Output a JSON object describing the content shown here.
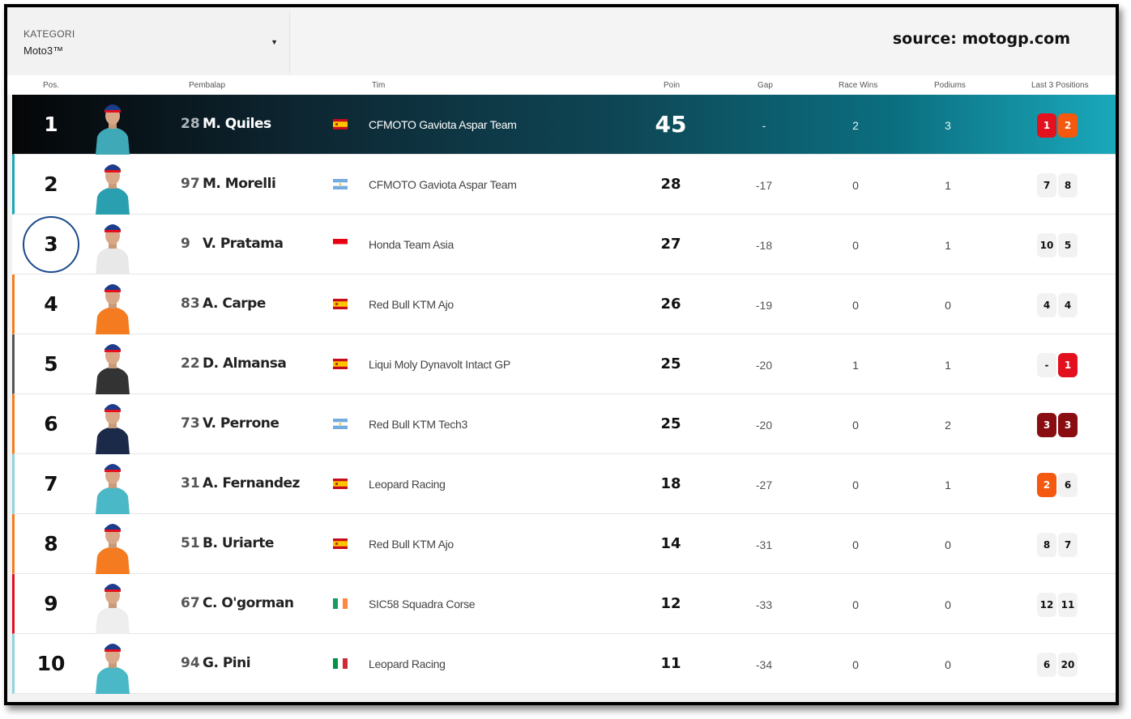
{
  "category": {
    "label": "KATEGORI",
    "value": "Moto3™"
  },
  "source_text": "source: motogp.com",
  "headers": {
    "pos": "Pos.",
    "rider": "Pembalap",
    "team": "Tim",
    "points": "Poin",
    "gap": "Gap",
    "wins": "Race Wins",
    "podiums": "Podiums",
    "last3": "Last 3 Positions"
  },
  "colors": {
    "accent_teal": "#1aa8bb",
    "podium_1": "#e3101e",
    "podium_2": "#f4590f",
    "podium_3": "#8a0d12",
    "highlight_circle": "#1a4a8a"
  },
  "rows": [
    {
      "pos": "1",
      "num": "28",
      "name": "M. Quiles",
      "flag": "spain-flag",
      "team": "CFMOTO Gaviota Aspar Team",
      "points": "45",
      "gap": "-",
      "wins": "2",
      "podiums": "3",
      "last": [
        "1",
        "2"
      ],
      "stripe": "#000000"
    },
    {
      "pos": "2",
      "num": "97",
      "name": "M. Morelli",
      "flag": "argentina-flag",
      "team": "CFMOTO Gaviota Aspar Team",
      "points": "28",
      "gap": "-17",
      "wins": "0",
      "podiums": "1",
      "last": [
        "7",
        "8"
      ],
      "stripe": "#1aa8bb"
    },
    {
      "pos": "3",
      "num": "9",
      "name": "V. Pratama",
      "flag": "indonesia-flag",
      "team": "Honda Team Asia",
      "points": "27",
      "gap": "-18",
      "wins": "0",
      "podiums": "1",
      "last": [
        "10",
        "5"
      ],
      "stripe": "#ffffff"
    },
    {
      "pos": "4",
      "num": "83",
      "name": "A. Carpe",
      "flag": "spain-flag",
      "team": "Red Bull KTM Ajo",
      "points": "26",
      "gap": "-19",
      "wins": "0",
      "podiums": "0",
      "last": [
        "4",
        "4"
      ],
      "stripe": "#f47b20"
    },
    {
      "pos": "5",
      "num": "22",
      "name": "D. Almansa",
      "flag": "spain-flag",
      "team": "Liqui Moly Dynavolt Intact GP",
      "points": "25",
      "gap": "-20",
      "wins": "1",
      "podiums": "1",
      "last": [
        "-",
        "1"
      ],
      "stripe": "#555555"
    },
    {
      "pos": "6",
      "num": "73",
      "name": "V. Perrone",
      "flag": "argentina-flag",
      "team": "Red Bull KTM Tech3",
      "points": "25",
      "gap": "-20",
      "wins": "0",
      "podiums": "2",
      "last": [
        "3",
        "3"
      ],
      "stripe": "#f47b20"
    },
    {
      "pos": "7",
      "num": "31",
      "name": "A. Fernandez",
      "flag": "spain-flag",
      "team": "Leopard Racing",
      "points": "18",
      "gap": "-27",
      "wins": "0",
      "podiums": "1",
      "last": [
        "2",
        "6"
      ],
      "stripe": "#8fd3e0"
    },
    {
      "pos": "8",
      "num": "51",
      "name": "B. Uriarte",
      "flag": "spain-flag",
      "team": "Red Bull KTM Ajo",
      "points": "14",
      "gap": "-31",
      "wins": "0",
      "podiums": "0",
      "last": [
        "8",
        "7"
      ],
      "stripe": "#f47b20"
    },
    {
      "pos": "9",
      "num": "67",
      "name": "C. O'gorman",
      "flag": "ireland-flag",
      "team": "SIC58 Squadra Corse",
      "points": "12",
      "gap": "-33",
      "wins": "0",
      "podiums": "0",
      "last": [
        "12",
        "11"
      ],
      "stripe": "#e3101e"
    },
    {
      "pos": "10",
      "num": "94",
      "name": "G. Pini",
      "flag": "italy-flag",
      "team": "Leopard Racing",
      "points": "11",
      "gap": "-34",
      "wins": "0",
      "podiums": "0",
      "last": [
        "6",
        "20"
      ],
      "stripe": "#8fd3e0"
    }
  ]
}
